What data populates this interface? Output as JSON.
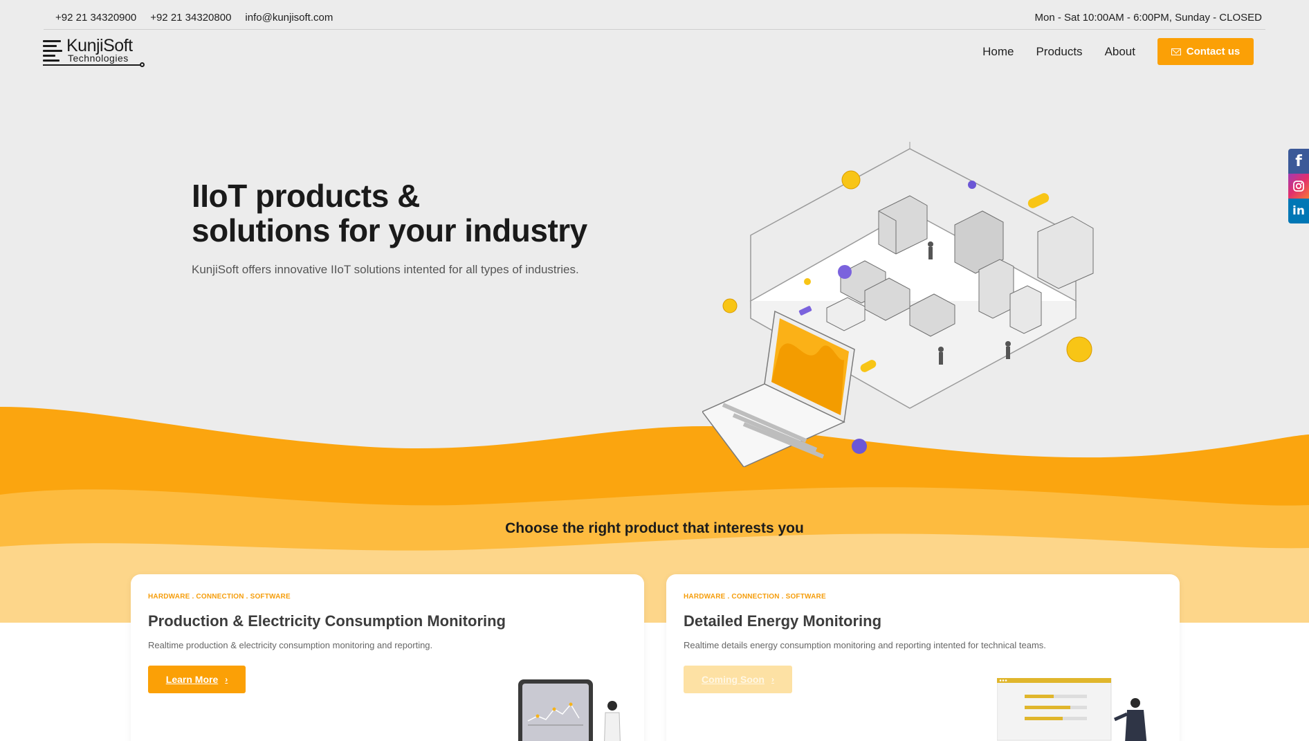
{
  "topbar": {
    "phone1": "+92 21 34320900",
    "phone2": "+92 21 34320800",
    "email": "info@kunjisoft.com",
    "hours": "Mon - Sat 10:00AM - 6:00PM, Sunday - CLOSED"
  },
  "logo": {
    "name": "KunjiSoft",
    "subtitle": "Technologies"
  },
  "nav": {
    "items": [
      {
        "label": "Home"
      },
      {
        "label": "Products"
      },
      {
        "label": "About"
      }
    ],
    "contact_label": "Contact us"
  },
  "hero": {
    "title_line1": "IIoT products &",
    "title_line2": "solutions for your industry",
    "subtitle": "KunjiSoft offers innovative IIoT solutions intented for all types of industries."
  },
  "products_section": {
    "title": "Choose the right product that interests you",
    "cards": [
      {
        "tags": "HARDWARE . CONNECTION . SOFTWARE",
        "title": "Production & Electricity Consumption Monitoring",
        "description": "Realtime production & electricity consumption monitoring and reporting.",
        "button": "Learn More"
      },
      {
        "tags": "HARDWARE . CONNECTION . SOFTWARE",
        "title": "Detailed Energy Monitoring",
        "description": "Realtime details energy consumption monitoring and reporting intented for technical teams.",
        "button": "Coming Soon"
      }
    ]
  },
  "social": [
    {
      "icon": "facebook-icon"
    },
    {
      "icon": "instagram-icon"
    },
    {
      "icon": "linkedin-icon"
    }
  ],
  "colors": {
    "accent": "#fba006",
    "wave_dark": "#fba50f",
    "wave_mid": "#fdbd45",
    "wave_light": "#fdd88c",
    "background": "#ececec"
  }
}
